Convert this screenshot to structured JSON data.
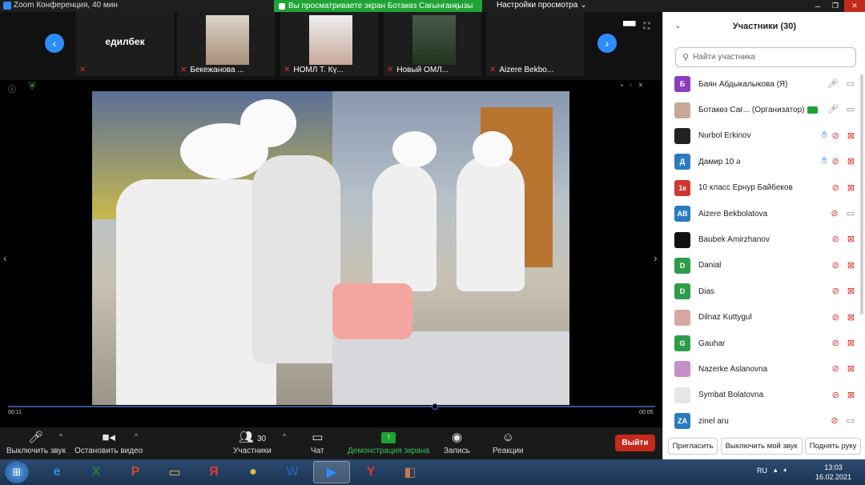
{
  "window": {
    "title": "Zoom Конференция, 40 мин",
    "share_banner": "Вы просматриваете экран Ботакөз Сағынғанқызы",
    "view_settings": "Настройки просмотра"
  },
  "strip": {
    "tiles": [
      {
        "name": "едилбек",
        "label": ""
      },
      {
        "name": "",
        "label": "Бекежанова ..."
      },
      {
        "name": "",
        "label": "НОМЛ Т. Кү..."
      },
      {
        "name": "",
        "label": "Новый ОМЛ..."
      },
      {
        "name": "",
        "label": "Aizere Bekbo..."
      }
    ]
  },
  "share": {
    "time_left": "00:11",
    "time_right": "00:05",
    "progress": 0.66
  },
  "toolbar": {
    "mute_label": "Выключить звук",
    "video_label": "Остановить видео",
    "participants_label": "Участники",
    "participants_count": "30",
    "chat_label": "Чат",
    "share_label": "Демонстрация экрана",
    "record_label": "Запись",
    "reactions_label": "Реакции",
    "leave_label": "Выйти"
  },
  "panel": {
    "title": "Участники (30)",
    "search_placeholder": "Найти участника",
    "participants": [
      {
        "name": "Баян Абдыкалыкова (Я)",
        "avatar_text": "Б",
        "avatar_color": "#8a3fbf",
        "mic_off": false,
        "cam_off": false,
        "hand": false,
        "host": false
      },
      {
        "name": "Ботакөз Сағ... (Организатор)",
        "avatar_text": "",
        "avatar_color": "#c9a89a",
        "mic_off": false,
        "cam_off": false,
        "hand": false,
        "host": true
      },
      {
        "name": "Nurbol Erkinov",
        "avatar_text": "",
        "avatar_color": "#222222",
        "mic_off": true,
        "cam_off": true,
        "hand": true,
        "host": false
      },
      {
        "name": "Дамир 10 ә",
        "avatar_text": "Д",
        "avatar_color": "#2b7bc1",
        "mic_off": true,
        "cam_off": true,
        "hand": true,
        "host": false
      },
      {
        "name": "10 класс Ернур Байбеков",
        "avatar_text": "1к",
        "avatar_color": "#d0372d",
        "mic_off": true,
        "cam_off": true,
        "hand": false,
        "host": false
      },
      {
        "name": "Aizere Bekbolatova",
        "avatar_text": "AB",
        "avatar_color": "#2b7bc1",
        "mic_off": true,
        "cam_off": false,
        "hand": false,
        "host": false
      },
      {
        "name": "Baubek Amirzhanov",
        "avatar_text": "",
        "avatar_color": "#111111",
        "mic_off": true,
        "cam_off": true,
        "hand": false,
        "host": false
      },
      {
        "name": "Danial",
        "avatar_text": "D",
        "avatar_color": "#2e9d4a",
        "mic_off": true,
        "cam_off": true,
        "hand": false,
        "host": false
      },
      {
        "name": "Dias",
        "avatar_text": "D",
        "avatar_color": "#2e9d4a",
        "mic_off": true,
        "cam_off": true,
        "hand": false,
        "host": false
      },
      {
        "name": "Dilnaz Kuttygul",
        "avatar_text": "",
        "avatar_color": "#d9a6a0",
        "mic_off": true,
        "cam_off": true,
        "hand": false,
        "host": false
      },
      {
        "name": "Gauhar",
        "avatar_text": "G",
        "avatar_color": "#2e9d4a",
        "mic_off": true,
        "cam_off": true,
        "hand": false,
        "host": false
      },
      {
        "name": "Nazerke Aslanovna",
        "avatar_text": "",
        "avatar_color": "#c58fc9",
        "mic_off": true,
        "cam_off": true,
        "hand": false,
        "host": false
      },
      {
        "name": "Symbat Bolatovna",
        "avatar_text": "",
        "avatar_color": "#e6e6e6",
        "mic_off": true,
        "cam_off": true,
        "hand": false,
        "host": false
      },
      {
        "name": "zinel aru",
        "avatar_text": "ZA",
        "avatar_color": "#2b7bc1",
        "mic_off": true,
        "cam_off": false,
        "hand": false,
        "host": false
      }
    ],
    "invite_label": "Пригласить",
    "mute_all_label": "Выключить мой звук",
    "raise_hand_label": "Поднять руку"
  },
  "taskbar": {
    "apps": [
      {
        "icon": "internet-explorer-icon",
        "glyph": "e",
        "color": "#2c8fd6"
      },
      {
        "icon": "excel-icon",
        "glyph": "X",
        "color": "#1d7a3d"
      },
      {
        "icon": "powerpoint-icon",
        "glyph": "P",
        "color": "#c94a2a"
      },
      {
        "icon": "folder-icon",
        "glyph": "▭",
        "color": "#e8b83c"
      },
      {
        "icon": "yandex-icon",
        "glyph": "Я",
        "color": "#e03a2f"
      },
      {
        "icon": "chrome-icon",
        "glyph": "●",
        "color": "#e8b83c"
      },
      {
        "icon": "word-icon",
        "glyph": "W",
        "color": "#2b5aa8"
      },
      {
        "icon": "zoom-icon",
        "glyph": "▶",
        "color": "#2d8cff"
      },
      {
        "icon": "yandex-browser-icon",
        "glyph": "Y",
        "color": "#e03a2f"
      },
      {
        "icon": "media-icon",
        "glyph": "◧",
        "color": "#c47b3c"
      }
    ],
    "lang": "RU",
    "time": "13:03",
    "date": "16.02.2021"
  }
}
